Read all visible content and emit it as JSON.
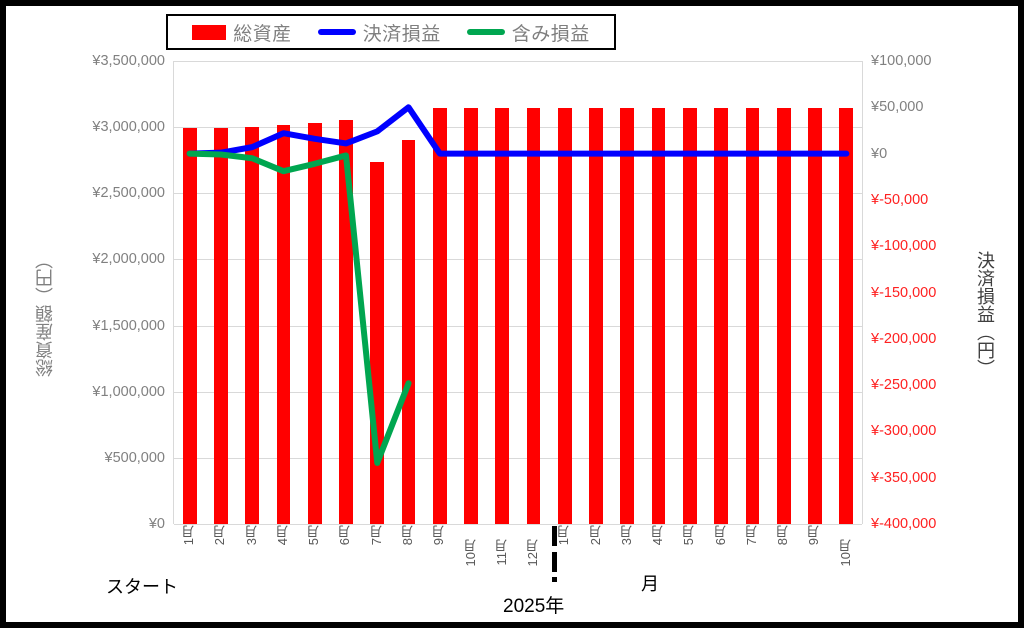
{
  "legend": {
    "items": [
      {
        "label": "総資産",
        "type": "bar",
        "color": "#ff0000"
      },
      {
        "label": "決済損益",
        "type": "line",
        "color": "#0000ff"
      },
      {
        "label": "含み損益",
        "type": "line",
        "color": "#00a650"
      }
    ]
  },
  "axes": {
    "left_title": "総資産額（円）",
    "right_title": "決済損益（円）",
    "left_ticks": [
      "¥0",
      "¥500,000",
      "¥1,000,000",
      "¥1,500,000",
      "¥2,000,000",
      "¥2,500,000",
      "¥3,000,000",
      "¥3,500,000"
    ],
    "right_ticks": [
      "¥-400,000",
      "¥-350,000",
      "¥-300,000",
      "¥-250,000",
      "¥-200,000",
      "¥-150,000",
      "¥-100,000",
      "¥-50,000",
      "¥0",
      "¥50,000",
      "¥100,000"
    ]
  },
  "groups": {
    "start": "スタート",
    "year": "2025年",
    "month": "月"
  },
  "chart_data": {
    "type": "bar",
    "title": "",
    "xlabel": "月",
    "ylabel": "総資産額（円）",
    "y2label": "決済損益（円）",
    "ylim": [
      0,
      3500000
    ],
    "y2lim": [
      -400000,
      100000
    ],
    "grid": true,
    "legend_position": "top",
    "categories": [
      "1月",
      "2月",
      "3月",
      "4月",
      "5月",
      "6月",
      "7月",
      "8月",
      "9月",
      "10月",
      "11月",
      "12月",
      "1月",
      "2月",
      "3月",
      "4月",
      "5月",
      "6月",
      "7月",
      "8月",
      "9月",
      "10月"
    ],
    "category_groups": [
      {
        "label": "スタート",
        "span": [
          0,
          0
        ]
      },
      {
        "label": "2025年",
        "span": [
          11,
          12
        ]
      },
      {
        "label": "月",
        "span": [
          12,
          21
        ]
      }
    ],
    "series": [
      {
        "name": "総資産",
        "type": "bar",
        "axis": "left",
        "color": "#ff0000",
        "values": [
          2995000,
          2990000,
          3000000,
          3020000,
          3030000,
          3055000,
          2735000,
          2900000,
          3145000,
          3145000,
          3145000,
          3145000,
          3145000,
          3145000,
          3145000,
          3145000,
          3145000,
          3145000,
          3145000,
          3145000,
          3145000,
          3145000
        ]
      },
      {
        "name": "決済損益",
        "type": "line",
        "axis": "right",
        "color": "#0000ff",
        "values": [
          0,
          1000,
          7000,
          22000,
          16000,
          11000,
          24000,
          50000,
          0,
          0,
          0,
          0,
          0,
          0,
          0,
          0,
          0,
          0,
          0,
          0,
          0,
          0
        ]
      },
      {
        "name": "含み損益",
        "type": "line",
        "axis": "right",
        "color": "#00a650",
        "values": [
          0,
          -1000,
          -5000,
          -19000,
          -11000,
          -2000,
          -334000,
          -248000,
          null,
          null,
          null,
          null,
          null,
          null,
          null,
          null,
          null,
          null,
          null,
          null,
          null,
          null
        ]
      }
    ]
  }
}
